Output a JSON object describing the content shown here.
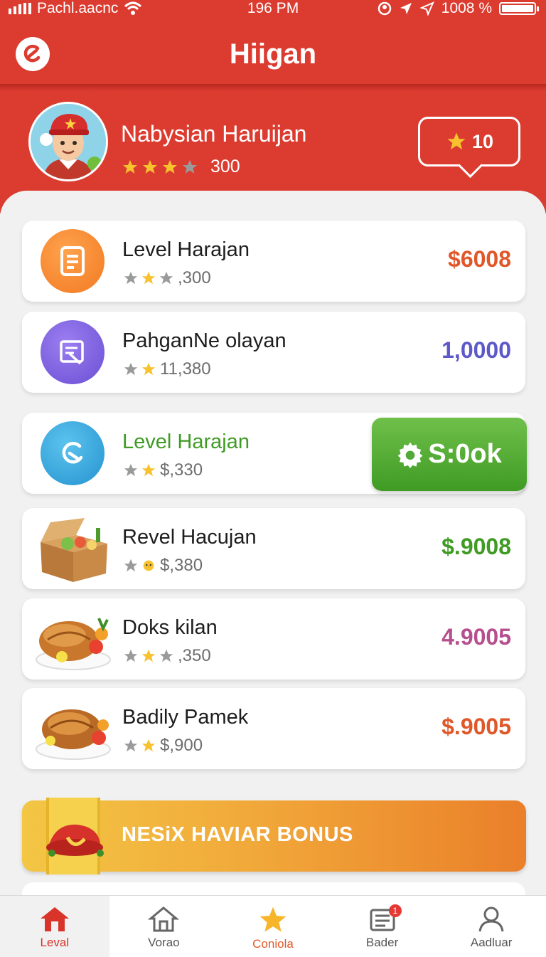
{
  "status_bar": {
    "carrier": "Pachl.​a​acnc",
    "time": "196 PM",
    "battery": "100​8 %"
  },
  "header": {
    "title": "Hiigan"
  },
  "profile": {
    "name": "Nabysian Haruijan",
    "stars_filled": 3,
    "stars_total": 4,
    "score": "300",
    "coins": "10"
  },
  "items": [
    {
      "title": "Level Harajan",
      "rating": ",300",
      "price": "$6008",
      "price_color": "#e0582a",
      "icon": "document-icon",
      "icon_color": "#f58a2e"
    },
    {
      "title": "PahganNe olayan",
      "rating": "11,380",
      "price": "1,0000",
      "price_color": "#5d59c9",
      "icon": "edit-document-icon",
      "icon_color": "#7b5fdc"
    },
    {
      "title": "Level Harajan",
      "rating": "$,330",
      "action": "S:0ok",
      "title_color": "#3f9b24",
      "icon": "refresh-icon",
      "icon_color": "#36a6dd"
    },
    {
      "title": "Revel Hacujan",
      "rating": "$,380",
      "price": "$.9008",
      "price_color": "#3f9b24",
      "icon": "food-box-icon"
    },
    {
      "title": "Doks kilan",
      "rating": ",350",
      "price": "4.9005",
      "price_color": "#b64f8d",
      "icon": "roast-chicken-icon"
    },
    {
      "title": "Badily Pamek",
      "rating": "$,900",
      "price": "$.9005",
      "price_color": "#e0582a",
      "icon": "roast-chicken-icon"
    }
  ],
  "bonus": {
    "label": "NESiX HAVIAR BONUS"
  },
  "nav": [
    {
      "label": "Leval",
      "icon": "home-icon"
    },
    {
      "label": "Vorao",
      "icon": "house-outline-icon"
    },
    {
      "label": "Coniola",
      "icon": "star-icon"
    },
    {
      "label": "Bader",
      "icon": "inbox-icon",
      "badge": "1"
    },
    {
      "label": "Aadluar",
      "icon": "user-icon"
    }
  ]
}
